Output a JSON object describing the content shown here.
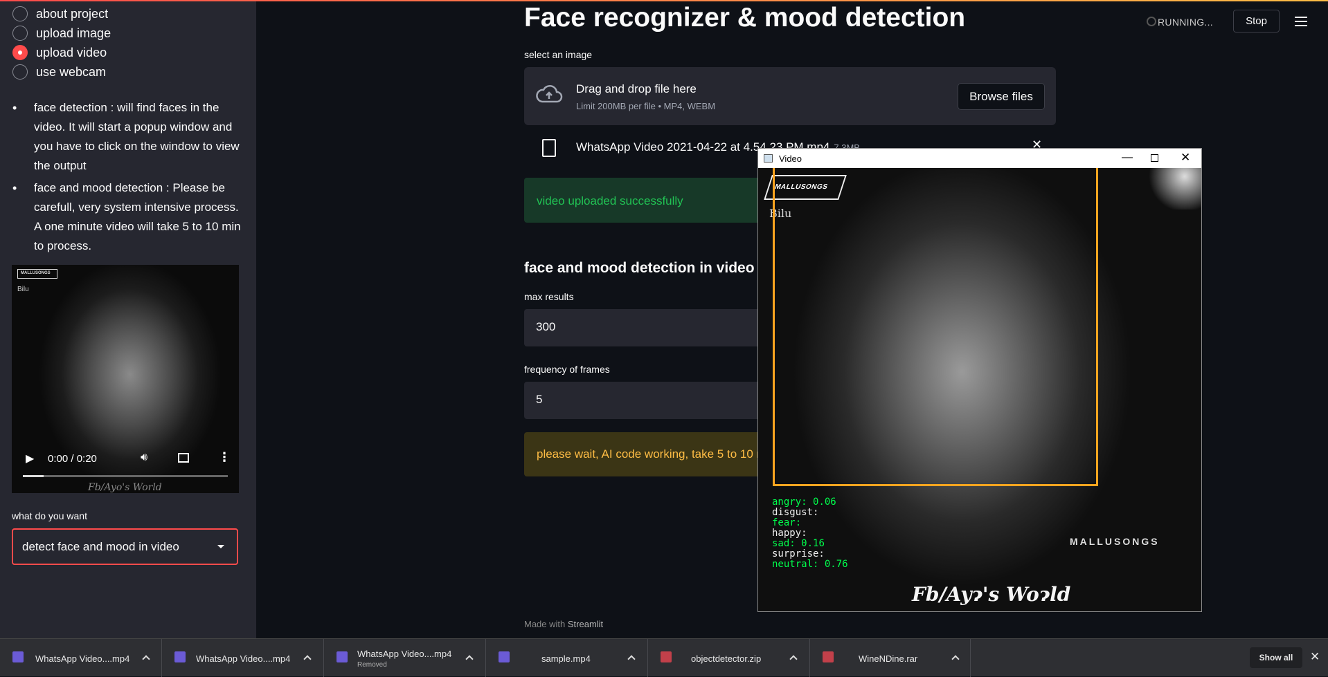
{
  "sidebar": {
    "radio_options": [
      {
        "label": "about project",
        "selected": false
      },
      {
        "label": "upload image",
        "selected": false
      },
      {
        "label": "upload video",
        "selected": true
      },
      {
        "label": "use webcam",
        "selected": false
      }
    ],
    "bullets": [
      "face detection : will find faces in the video. It will start a popup window and you have to click on the window to view the output",
      "face and mood detection : Please be carefull, very system intensive process. A one minute video will take 5 to 10 min to process."
    ],
    "video": {
      "time": "0:00 / 0:20",
      "logo": "MALLUSONGS",
      "overlay_name": "Bilu",
      "watermark": "Fb/Ayo's World",
      "progress_fraction": 0.1
    },
    "select_label": "what do you want",
    "select_value": "detect face and mood in video"
  },
  "header": {
    "title": "Face recognizer & mood detection",
    "status": "RUNNING...",
    "stop_label": "Stop"
  },
  "main": {
    "uploader_label": "select an image",
    "uploader_title": "Drag and drop file here",
    "uploader_sub": "Limit 200MB per file • MP4, WEBM",
    "browse_label": "Browse files",
    "file_name": "WhatsApp Video 2021-04-22 at 4.54.23 PM.mp4",
    "file_size": "7.3MB",
    "success_msg": "video uploaded successfully",
    "section_title": "face and mood detection in video",
    "max_results_label": "max results",
    "max_results_value": "300",
    "freq_label": "frequency of frames",
    "freq_value": "5",
    "warning_msg": "please wait, AI code working, take 5 to 10 min",
    "made_with_prefix": "Made with",
    "made_with_brand": "Streamlit"
  },
  "video_window": {
    "title": "Video",
    "logo": "MALLUSONGS",
    "overlay_name": "Bilu",
    "emotions": [
      {
        "label": "angry:",
        "value": "0.06",
        "color": "green"
      },
      {
        "label": "disgust:",
        "value": "",
        "color": "white"
      },
      {
        "label": "fear:",
        "value": "",
        "color": "green"
      },
      {
        "label": "happy:",
        "value": "",
        "color": "white"
      },
      {
        "label": "sad:",
        "value": "0.16",
        "color": "green"
      },
      {
        "label": "surprise:",
        "value": "",
        "color": "white"
      },
      {
        "label": "neutral:",
        "value": "0.76",
        "color": "green"
      }
    ],
    "brand_text": "MALLUSONGS",
    "watermark": "Fb/Ayɂ's Woɂld"
  },
  "downloads": {
    "items": [
      {
        "name": "WhatsApp Video....mp4",
        "sub": "",
        "icon_color": "#6b5bd6"
      },
      {
        "name": "WhatsApp Video....mp4",
        "sub": "",
        "icon_color": "#6b5bd6"
      },
      {
        "name": "WhatsApp Video....mp4",
        "sub": "Removed",
        "icon_color": "#6b5bd6"
      },
      {
        "name": "sample.mp4",
        "sub": "",
        "icon_color": "#6b5bd6"
      },
      {
        "name": "objectdetector.zip",
        "sub": "",
        "icon_color": "#c2404a"
      },
      {
        "name": "WineNDine.rar",
        "sub": "",
        "icon_color": "#c2404a"
      }
    ],
    "show_all_label": "Show all"
  },
  "colors": {
    "accent": "#ff4b4b",
    "background": "#0e1117",
    "sidebar": "#262730",
    "success_text": "#21c354",
    "warning_text": "#ffbd45",
    "face_box": "#ffa51f"
  }
}
